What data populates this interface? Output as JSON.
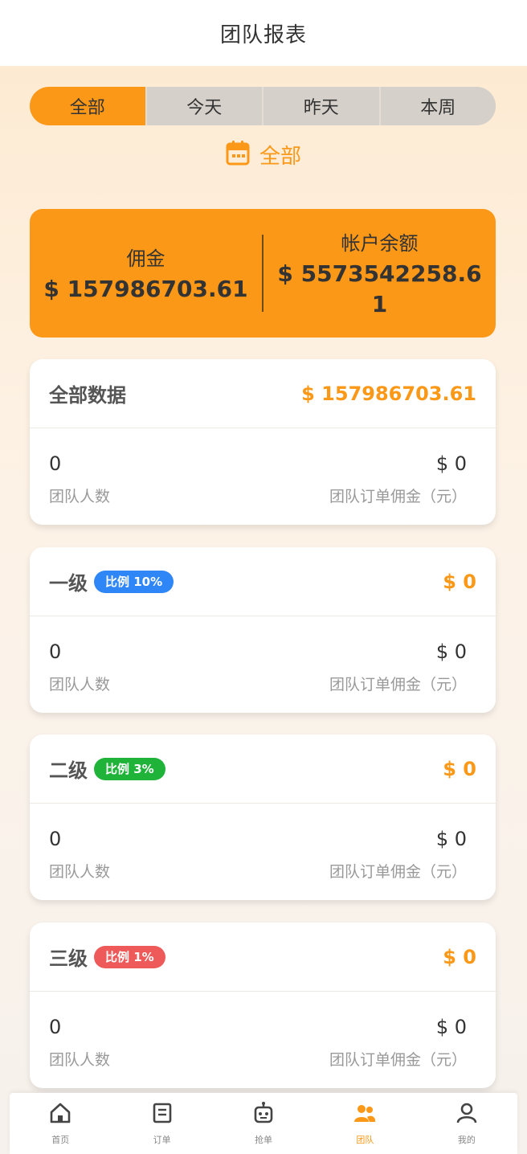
{
  "header": {
    "title": "团队报表"
  },
  "tabs": [
    {
      "label": "全部",
      "active": true
    },
    {
      "label": "今天",
      "active": false
    },
    {
      "label": "昨天",
      "active": false
    },
    {
      "label": "本周",
      "active": false
    }
  ],
  "date_range": {
    "label": "全部",
    "icon": "calendar-icon"
  },
  "summary": {
    "commission_label": "佣金",
    "commission_value": "$ 157986703.61",
    "balance_label": "帐户余额",
    "balance_value": "$ 5573542258.61"
  },
  "cards": [
    {
      "title": "全部数据",
      "badge": "",
      "amount": "$ 157986703.61",
      "team_count": "0",
      "team_count_label": "团队人数",
      "team_commission": "$ 0",
      "team_commission_label": "团队订单佣金（元）"
    },
    {
      "title": "一级",
      "badge": "比例 10%",
      "badge_color": "#2f86f6",
      "amount": "$ 0",
      "team_count": "0",
      "team_count_label": "团队人数",
      "team_commission": "$ 0",
      "team_commission_label": "团队订单佣金（元）"
    },
    {
      "title": "二级",
      "badge": "比例 3%",
      "badge_color": "#1fb33a",
      "amount": "$ 0",
      "team_count": "0",
      "team_count_label": "团队人数",
      "team_commission": "$ 0",
      "team_commission_label": "团队订单佣金（元）"
    },
    {
      "title": "三级",
      "badge": "比例 1%",
      "badge_color": "#ee5a5a",
      "amount": "$ 0",
      "team_count": "0",
      "team_count_label": "团队人数",
      "team_commission": "$ 0",
      "team_commission_label": "团队订单佣金（元）"
    }
  ],
  "nav": [
    {
      "label": "首页",
      "icon": "home-icon",
      "active": false
    },
    {
      "label": "订单",
      "icon": "orders-icon",
      "active": false
    },
    {
      "label": "抢单",
      "icon": "robot-icon",
      "active": false
    },
    {
      "label": "团队",
      "icon": "team-icon",
      "active": true
    },
    {
      "label": "我的",
      "icon": "user-icon",
      "active": false
    }
  ],
  "colors": {
    "accent": "#fc9817",
    "tab_inactive": "#d6d0ca"
  }
}
